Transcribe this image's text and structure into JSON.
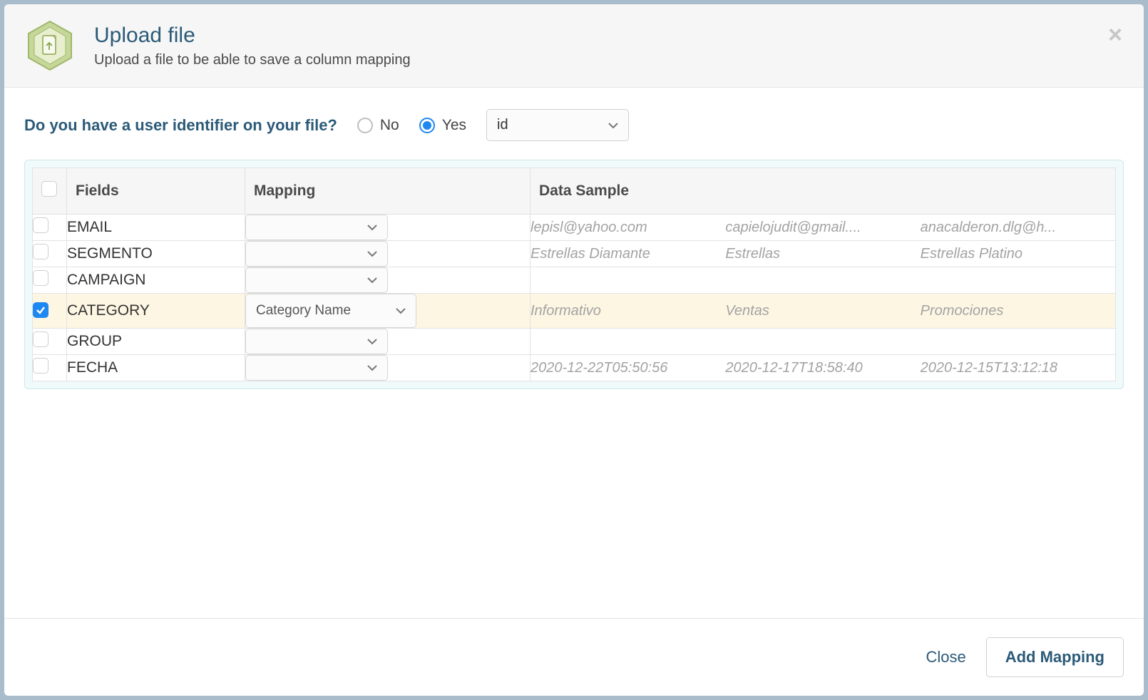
{
  "header": {
    "title": "Upload file",
    "subtitle": "Upload a file to be able to save a column mapping"
  },
  "question": {
    "text": "Do you have a user identifier on your file?",
    "no_label": "No",
    "yes_label": "Yes",
    "selected": "yes",
    "id_select_value": "id"
  },
  "columns": {
    "fields": "Fields",
    "mapping": "Mapping",
    "sample": "Data Sample"
  },
  "rows": [
    {
      "field": "EMAIL",
      "checked": false,
      "mapping": "",
      "samples": [
        "lepisl@yahoo.com",
        "capielojudit@gmail....",
        "anacalderon.dlg@h..."
      ]
    },
    {
      "field": "SEGMENTO",
      "checked": false,
      "mapping": "",
      "samples": [
        "Estrellas Diamante",
        "Estrellas",
        "Estrellas Platino"
      ]
    },
    {
      "field": "CAMPAIGN",
      "checked": false,
      "mapping": "",
      "samples": [
        "",
        "",
        ""
      ]
    },
    {
      "field": "CATEGORY",
      "checked": true,
      "mapping": "Category Name",
      "samples": [
        "Informativo",
        "Ventas",
        "Promociones"
      ]
    },
    {
      "field": "GROUP",
      "checked": false,
      "mapping": "",
      "samples": [
        "",
        "",
        ""
      ]
    },
    {
      "field": "FECHA",
      "checked": false,
      "mapping": "",
      "samples": [
        "2020-12-22T05:50:56",
        "2020-12-17T18:58:40",
        "2020-12-15T13:12:18"
      ]
    }
  ],
  "footer": {
    "close": "Close",
    "add": "Add Mapping"
  }
}
